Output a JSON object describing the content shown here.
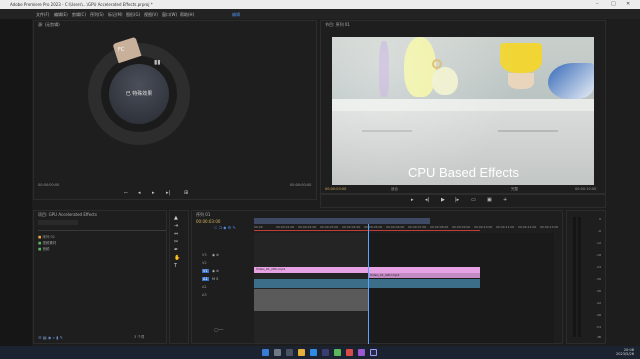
{
  "window": {
    "title": "Adobe Premiere Pro 2023 - C:\\Users\\...\\GPU Accelerated Effects.prproj *",
    "minimize": "–",
    "maximize": "□",
    "close": "✕"
  },
  "menu": {
    "items": [
      "文件(F)",
      "编辑(E)",
      "剪辑(C)",
      "序列(S)",
      "标记(M)",
      "图形(G)",
      "视图(V)",
      "窗口(W)",
      "帮助(H)"
    ],
    "workspace": "编辑"
  },
  "source": {
    "header": "源: (无剪辑)",
    "radial_segment": "FC",
    "radial_center": "已 特殊效果",
    "timecode_left": "00:00:00:00",
    "timecode_right": "00:00:00:00"
  },
  "program": {
    "header": "节目: 序列 01",
    "overlay_text": "CPU Based Effects",
    "timecode_left": "00:00:03:00",
    "fit": "适合",
    "quality": "完整",
    "duration": "00:00:10:00"
  },
  "project": {
    "header": "项目: GPU Accelerated Effects",
    "search_placeholder": "",
    "items": [
      "序列 01",
      "视频素材",
      "音频"
    ],
    "item_count": "3 个项"
  },
  "timeline": {
    "header": "序列 01",
    "timecode": "00:00:03:00",
    "ruler": [
      "00:00",
      "00:00:01:00",
      "00:00:02:00",
      "00:00:03:00",
      "00:00:04:00",
      "00:00:05:00",
      "00:00:06:00",
      "00:00:07:00",
      "00:00:08:00",
      "00:00:09:00",
      "00:00:10:00",
      "00:00:11:00",
      "00:00:12:00",
      "00:00:13:00"
    ],
    "tracks": [
      "V3",
      "V2",
      "V1",
      "A1",
      "A2",
      "A3"
    ],
    "clip_v1_a": "Video_01_CPU.mp4",
    "clip_v1_b": "Video_01_GPU.mp4",
    "playhead_progress": 0.23
  },
  "meter": {
    "labels": [
      "0",
      "-6",
      "-12",
      "-18",
      "-24",
      "-30",
      "-36",
      "-42",
      "-48",
      "-54",
      "dB"
    ]
  },
  "taskbar": {
    "time": "20:08",
    "date": "2023/5/26"
  },
  "colors": {
    "accent_blue": "#4b8fe8",
    "clip_pink": "#e6a2e2",
    "audio_teal": "#3c6e8a",
    "playhead": "#5aa4ff"
  }
}
